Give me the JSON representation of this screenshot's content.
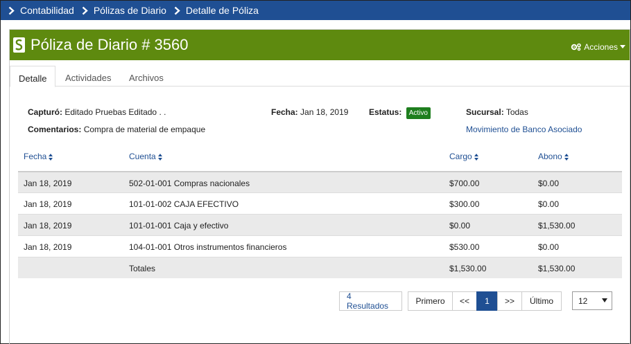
{
  "breadcrumb": [
    "Contabilidad",
    "Pólizas de Diario",
    "Detalle de Póliza"
  ],
  "header": {
    "title": "Póliza de Diario # 3560",
    "actions_label": "Acciones"
  },
  "tabs": [
    "Detalle",
    "Actividades",
    "Archivos"
  ],
  "info": {
    "capturo_label": "Capturó:",
    "capturo_value": "Editado Pruebas Editado . .",
    "fecha_label": "Fecha:",
    "fecha_value": "Jan 18, 2019",
    "estatus_label": "Estatus:",
    "estatus_badge": "Activo",
    "sucursal_label": "Sucursal:",
    "sucursal_value": "Todas",
    "comentarios_label": "Comentarios:",
    "comentarios_value": "Compra de material de empaque",
    "bank_link": "Movimiento de Banco Asociado"
  },
  "table": {
    "headers": [
      "Fecha",
      "Cuenta",
      "Cargo",
      "Abono"
    ],
    "rows": [
      [
        "Jan 18, 2019",
        "502-01-001 Compras nacionales",
        "$700.00",
        "$0.00"
      ],
      [
        "Jan 18, 2019",
        "101-01-002 CAJA EFECTIVO",
        "$300.00",
        "$0.00"
      ],
      [
        "Jan 18, 2019",
        "101-01-001 Caja y efectivo",
        "$0.00",
        "$1,530.00"
      ],
      [
        "Jan 18, 2019",
        "104-01-001 Otros instrumentos financieros",
        "$530.00",
        "$0.00"
      ]
    ],
    "totals": {
      "label": "Totales",
      "cargo": "$1,530.00",
      "abono": "$1,530.00"
    }
  },
  "pagination": {
    "results": "4 Resultados",
    "first": "Primero",
    "prev": "<<",
    "current": "1",
    "next": ">>",
    "last": "Último",
    "page_size": "12"
  },
  "colors": {
    "primary": "#1f4f93",
    "header_green": "#5e8a0f",
    "badge_green": "#1e7e1e"
  }
}
